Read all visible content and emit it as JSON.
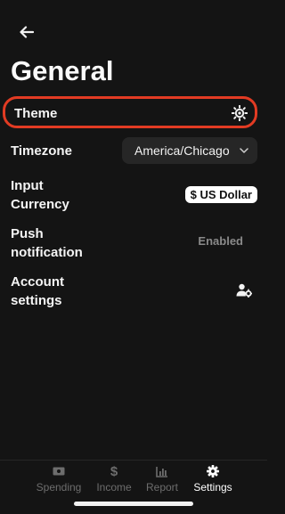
{
  "header": {
    "title": "General"
  },
  "rows": {
    "theme": {
      "label": "Theme"
    },
    "timezone": {
      "label": "Timezone",
      "value": "America/Chicago"
    },
    "input_currency": {
      "label_line1": "Input",
      "label_line2": "Currency",
      "value": "$ US Dollar"
    },
    "push": {
      "label_line1": "Push",
      "label_line2": "notification",
      "status": "Enabled"
    },
    "account": {
      "label_line1": "Account",
      "label_line2": "settings"
    }
  },
  "tabs": [
    {
      "label": "Spending",
      "icon": "banknote-icon"
    },
    {
      "label": "Income",
      "icon": "dollar-icon"
    },
    {
      "label": "Report",
      "icon": "bar-chart-icon"
    },
    {
      "label": "Settings",
      "icon": "gear-icon",
      "active": true
    }
  ],
  "colors": {
    "background": "#141414",
    "highlight": "#e23b23",
    "inactive_tab": "#6d6d6d",
    "active_tab": "#ffffff"
  }
}
